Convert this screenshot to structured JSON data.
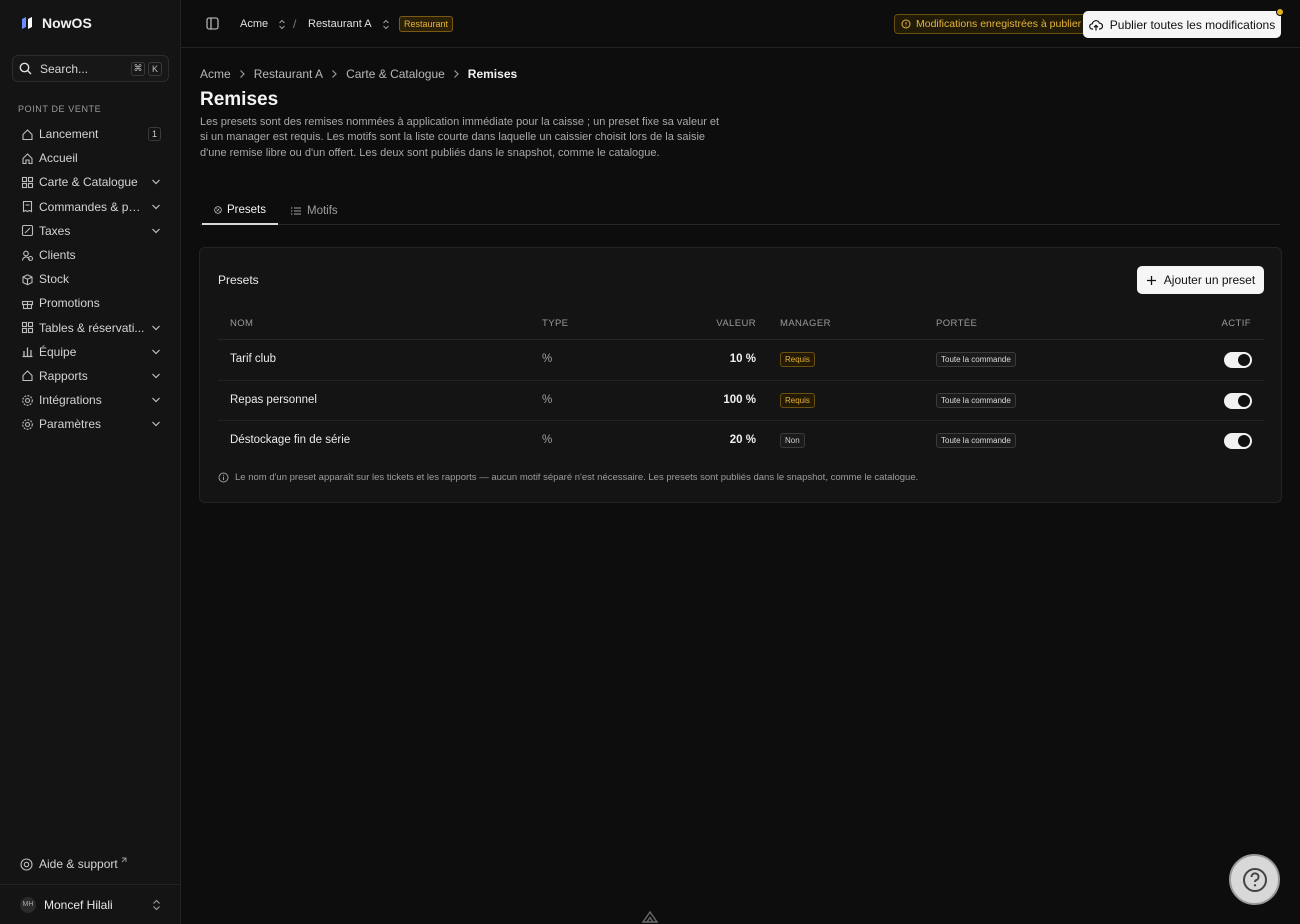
{
  "app": {
    "name": "NowOS"
  },
  "sidebar": {
    "search_label": "Search...",
    "search_keys": [
      "⌘",
      "K"
    ],
    "section_title": "POINT DE VENTE",
    "items": [
      {
        "label": "Lancement",
        "icon": "rocket-icon",
        "count": "1"
      },
      {
        "label": "Accueil",
        "icon": "home-icon"
      },
      {
        "label": "Carte & Catalogue",
        "icon": "grid-icon",
        "expandable": true
      },
      {
        "label": "Commandes & pai...",
        "icon": "receipt-icon",
        "expandable": true
      },
      {
        "label": "Taxes",
        "icon": "percent-icon",
        "expandable": true
      },
      {
        "label": "Clients",
        "icon": "users-icon"
      },
      {
        "label": "Stock",
        "icon": "box-icon"
      },
      {
        "label": "Promotions",
        "icon": "gift-icon"
      },
      {
        "label": "Tables & réservati...",
        "icon": "grid-icon",
        "expandable": true
      },
      {
        "label": "Équipe",
        "icon": "chart-icon",
        "expandable": true
      },
      {
        "label": "Rapports",
        "icon": "rocket-icon",
        "expandable": true
      },
      {
        "label": "Intégrations",
        "icon": "gear-icon",
        "expandable": true
      },
      {
        "label": "Paramètres",
        "icon": "gear-icon",
        "expandable": true
      }
    ],
    "help_label": "Aide & support",
    "user": {
      "initials": "MH",
      "name": "Moncef Hilali"
    }
  },
  "topbar": {
    "org": "Acme",
    "separator": "/",
    "site": "Restaurant A",
    "site_badge": "Restaurant",
    "pending_label": "Modifications enregistrées à publier",
    "publish_label": "Publier toutes les modifications"
  },
  "breadcrumb": [
    "Acme",
    "Restaurant A",
    "Carte & Catalogue",
    "Remises"
  ],
  "page": {
    "title": "Remises",
    "description": "Les presets sont des remises nommées à application immédiate pour la caisse ; un preset fixe sa valeur et si un manager est requis. Les motifs sont la liste courte dans laquelle un caissier choisit lors de la saisie d'une remise libre ou d'un offert. Les deux sont publiés dans le snapshot, comme le catalogue."
  },
  "tabs": [
    {
      "label": "Presets",
      "active": true
    },
    {
      "label": "Motifs",
      "active": false
    }
  ],
  "presets_card": {
    "title": "Presets",
    "add_label": "Ajouter un preset",
    "columns": [
      "NOM",
      "TYPE",
      "VALEUR",
      "MANAGER",
      "PORTÉE",
      "ACTIF"
    ],
    "rows": [
      {
        "name": "Tarif club",
        "type": "%",
        "value": "10 %",
        "manager": "Requis",
        "scope": "Toute la commande",
        "active": true
      },
      {
        "name": "Repas personnel",
        "type": "%",
        "value": "100 %",
        "manager": "Requis",
        "scope": "Toute la commande",
        "active": true
      },
      {
        "name": "Déstockage fin de série",
        "type": "%",
        "value": "20 %",
        "manager": "Non",
        "scope": "Toute la commande",
        "active": true
      }
    ],
    "note": "Le nom d'un preset apparaît sur les tickets et les rapports — aucun motif séparé n'est nécessaire. Les presets sont publiés dans le snapshot, comme le catalogue."
  },
  "colors": {
    "accent_warning": "#e5b23a",
    "background": "#0d0d0d",
    "sidebar": "#141414"
  }
}
